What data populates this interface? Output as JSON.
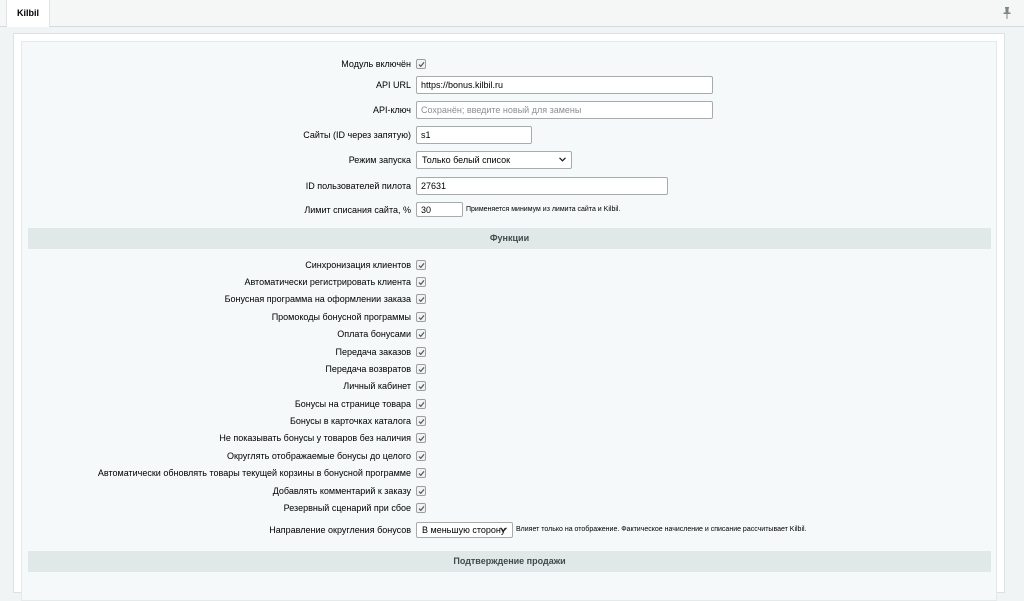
{
  "tab": {
    "title": "Kilbil"
  },
  "main": {
    "enabled_label": "Модуль включён",
    "api_url_label": "API URL",
    "api_url_value": "https://bonus.kilbil.ru",
    "api_key_label": "API-ключ",
    "api_key_placeholder": "Сохранён; введите новый для замены",
    "sites_label": "Сайты (ID через запятую)",
    "sites_value": "s1",
    "mode_label": "Режим запуска",
    "mode_value": "Только белый список",
    "pilot_label": "ID пользователей пилота",
    "pilot_value": "27631",
    "limit_label": "Лимит списания сайта, %",
    "limit_value": "30",
    "limit_hint": "Применяется минимум из лимита сайта и Kilbil."
  },
  "functions": {
    "header": "Функции",
    "items": [
      {
        "label": "Синхронизация клиентов",
        "checked": true
      },
      {
        "label": "Автоматически регистрировать клиента",
        "checked": true
      },
      {
        "label": "Бонусная программа на оформлении заказа",
        "checked": true
      },
      {
        "label": "Промокоды бонусной программы",
        "checked": true
      },
      {
        "label": "Оплата бонусами",
        "checked": true
      },
      {
        "label": "Передача заказов",
        "checked": true
      },
      {
        "label": "Передача возвратов",
        "checked": true
      },
      {
        "label": "Личный кабинет",
        "checked": true
      },
      {
        "label": "Бонусы на странице товара",
        "checked": true
      },
      {
        "label": "Бонусы в карточках каталога",
        "checked": true
      },
      {
        "label": "Не показывать бонусы у товаров без наличия",
        "checked": true
      },
      {
        "label": "Округлять отображаемые бонусы до целого",
        "checked": true
      },
      {
        "label": "Автоматически обновлять товары текущей корзины в бонусной программе",
        "checked": true
      },
      {
        "label": "Добавлять комментарий к заказу",
        "checked": true
      },
      {
        "label": "Резервный сценарий при сбое",
        "checked": true
      }
    ],
    "rounding_label": "Направление округления бонусов",
    "rounding_value": "В меньшую сторону",
    "rounding_hint": "Влияет только на отображение. Фактическое начисление и списание рассчитывает Kilbil."
  },
  "confirm": {
    "header": "Подтверждение продажи"
  }
}
